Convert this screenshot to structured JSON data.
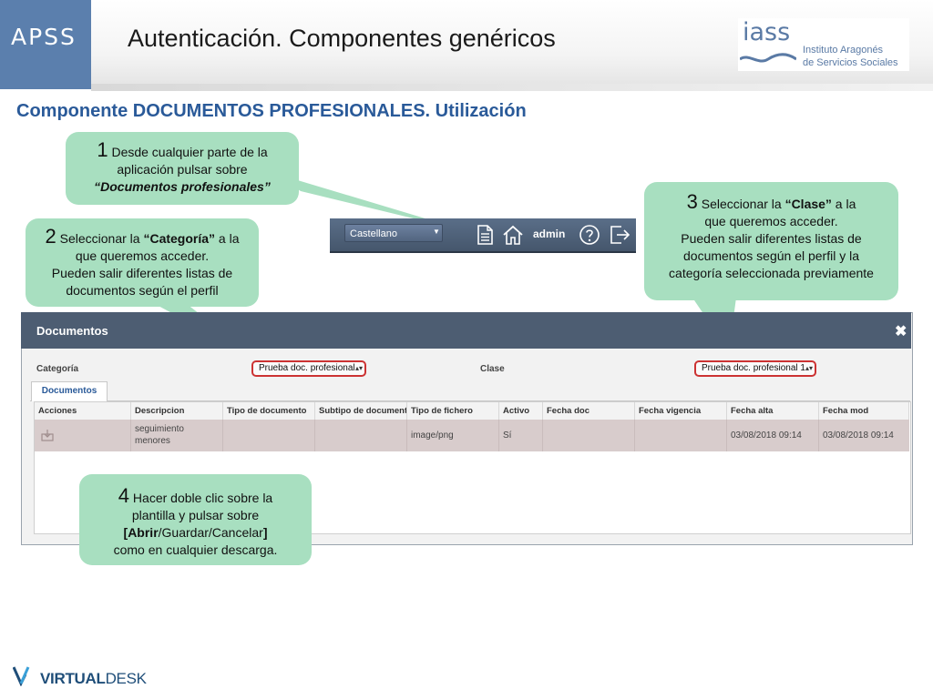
{
  "header": {
    "apss_label": "APSS",
    "title": "Autenticación. Componentes genéricos",
    "logo_word": "iass",
    "logo_line1": "Instituto Aragonés",
    "logo_line2": "de Servicios Sociales"
  },
  "subtitle": "Componente DOCUMENTOS PROFESIONALES. Utilización",
  "toolbar": {
    "language_value": "Castellano",
    "user_label": "admin",
    "icons": [
      "document-icon",
      "home-icon",
      "help-icon",
      "logout-icon"
    ]
  },
  "callouts": {
    "step1": {
      "number": "1",
      "line1": "Desde cualquier parte de la",
      "line2": "aplicación pulsar sobre",
      "line3": "“Documentos profesionales”"
    },
    "step2": {
      "number": "2",
      "line1_pre": "Seleccionar la ",
      "line1_em": "“Categoría”",
      "line1_post": " a la",
      "line2": "que queremos acceder.",
      "line3": "Pueden salir diferentes listas de",
      "line4": "documentos según el perfil"
    },
    "step3": {
      "number": "3",
      "line1_pre": "Seleccionar la ",
      "line1_em": "“Clase”",
      "line1_post": " a la",
      "line2": "que queremos acceder.",
      "line3": "Pueden salir diferentes listas de",
      "line4": "documentos según el perfil y la",
      "line5": "categoría seleccionada previamente"
    },
    "step4": {
      "number": "4",
      "line1": "Hacer doble clic sobre la",
      "line2": "plantilla y pulsar sobre",
      "line3_open": "[",
      "line3_bold": "Abrir",
      "line3_rest": "/Guardar/Cancelar",
      "line3_close": "]",
      "line4": "como en cualquier descarga."
    }
  },
  "modal": {
    "title": "Documentos",
    "close_symbol": "✖",
    "categoria_label": "Categoría",
    "categoria_value": "Prueba doc. profesional",
    "clase_label": "Clase",
    "clase_value": "Prueba doc. profesional 1",
    "tab_label": "Documentos",
    "columns": [
      "Acciones",
      "Descripcion",
      "Tipo de documento",
      "Subtipo de document",
      "Tipo de fichero",
      "Activo",
      "Fecha doc",
      "Fecha vigencia",
      "Fecha alta",
      "Fecha mod"
    ],
    "row": {
      "descripcion_1": "seguimiento",
      "descripcion_2": "menores",
      "tipo_documento": "",
      "subtipo": "",
      "tipo_fichero": "image/png",
      "activo": "Sí",
      "fecha_doc": "",
      "fecha_vigencia": "",
      "fecha_alta": "03/08/2018 09:14",
      "fecha_mod": "03/08/2018 09:14"
    }
  },
  "footer": {
    "brand_bold": "VIRTUAL",
    "brand_light": "DESK"
  },
  "colors": {
    "accent_blue": "#2a5a99",
    "callout_green": "#a8dfc0",
    "modal_header": "#4d5d72",
    "highlight_red": "#cc3333",
    "row_selected": "#d8cccc"
  }
}
